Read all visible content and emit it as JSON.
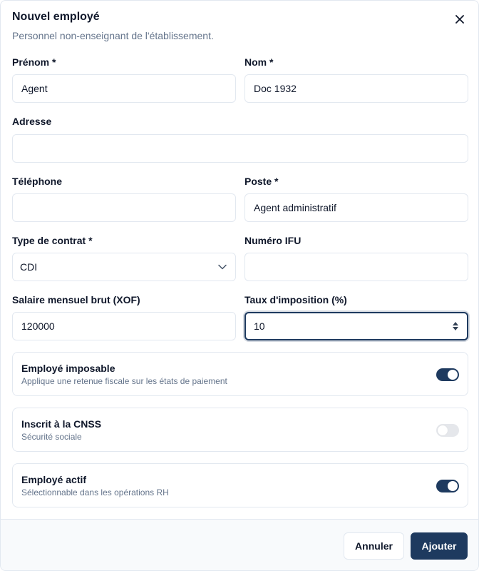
{
  "dialog": {
    "title": "Nouvel employé",
    "subtitle": "Personnel non-enseignant de l'établissement."
  },
  "form": {
    "prenom": {
      "label": "Prénom *",
      "value": "Agent"
    },
    "nom": {
      "label": "Nom *",
      "value": "Doc 1932"
    },
    "adresse": {
      "label": "Adresse",
      "value": ""
    },
    "telephone": {
      "label": "Téléphone",
      "value": ""
    },
    "poste": {
      "label": "Poste *",
      "value": "Agent administratif"
    },
    "type_contrat": {
      "label": "Type de contrat *",
      "value": "CDI"
    },
    "numero_ifu": {
      "label": "Numéro IFU",
      "value": ""
    },
    "salaire": {
      "label": "Salaire mensuel brut (XOF)",
      "value": "120000"
    },
    "taux": {
      "label": "Taux d'imposition (%)",
      "value": "10"
    }
  },
  "toggles": [
    {
      "title": "Employé imposable",
      "description": "Applique une retenue fiscale sur les états de paiement",
      "on": true
    },
    {
      "title": "Inscrit à la CNSS",
      "description": "Sécurité sociale",
      "on": false
    },
    {
      "title": "Employé actif",
      "description": "Sélectionnable dans les opérations RH",
      "on": true
    }
  ],
  "footer": {
    "cancel_label": "Annuler",
    "submit_label": "Ajouter"
  },
  "colors": {
    "accent": "#1e3a5f",
    "border": "#e2e8f0",
    "muted_text": "#64748b"
  },
  "icons": {
    "close": "close-icon",
    "select": "chevron-down-icon",
    "number": "spinner-icon"
  }
}
